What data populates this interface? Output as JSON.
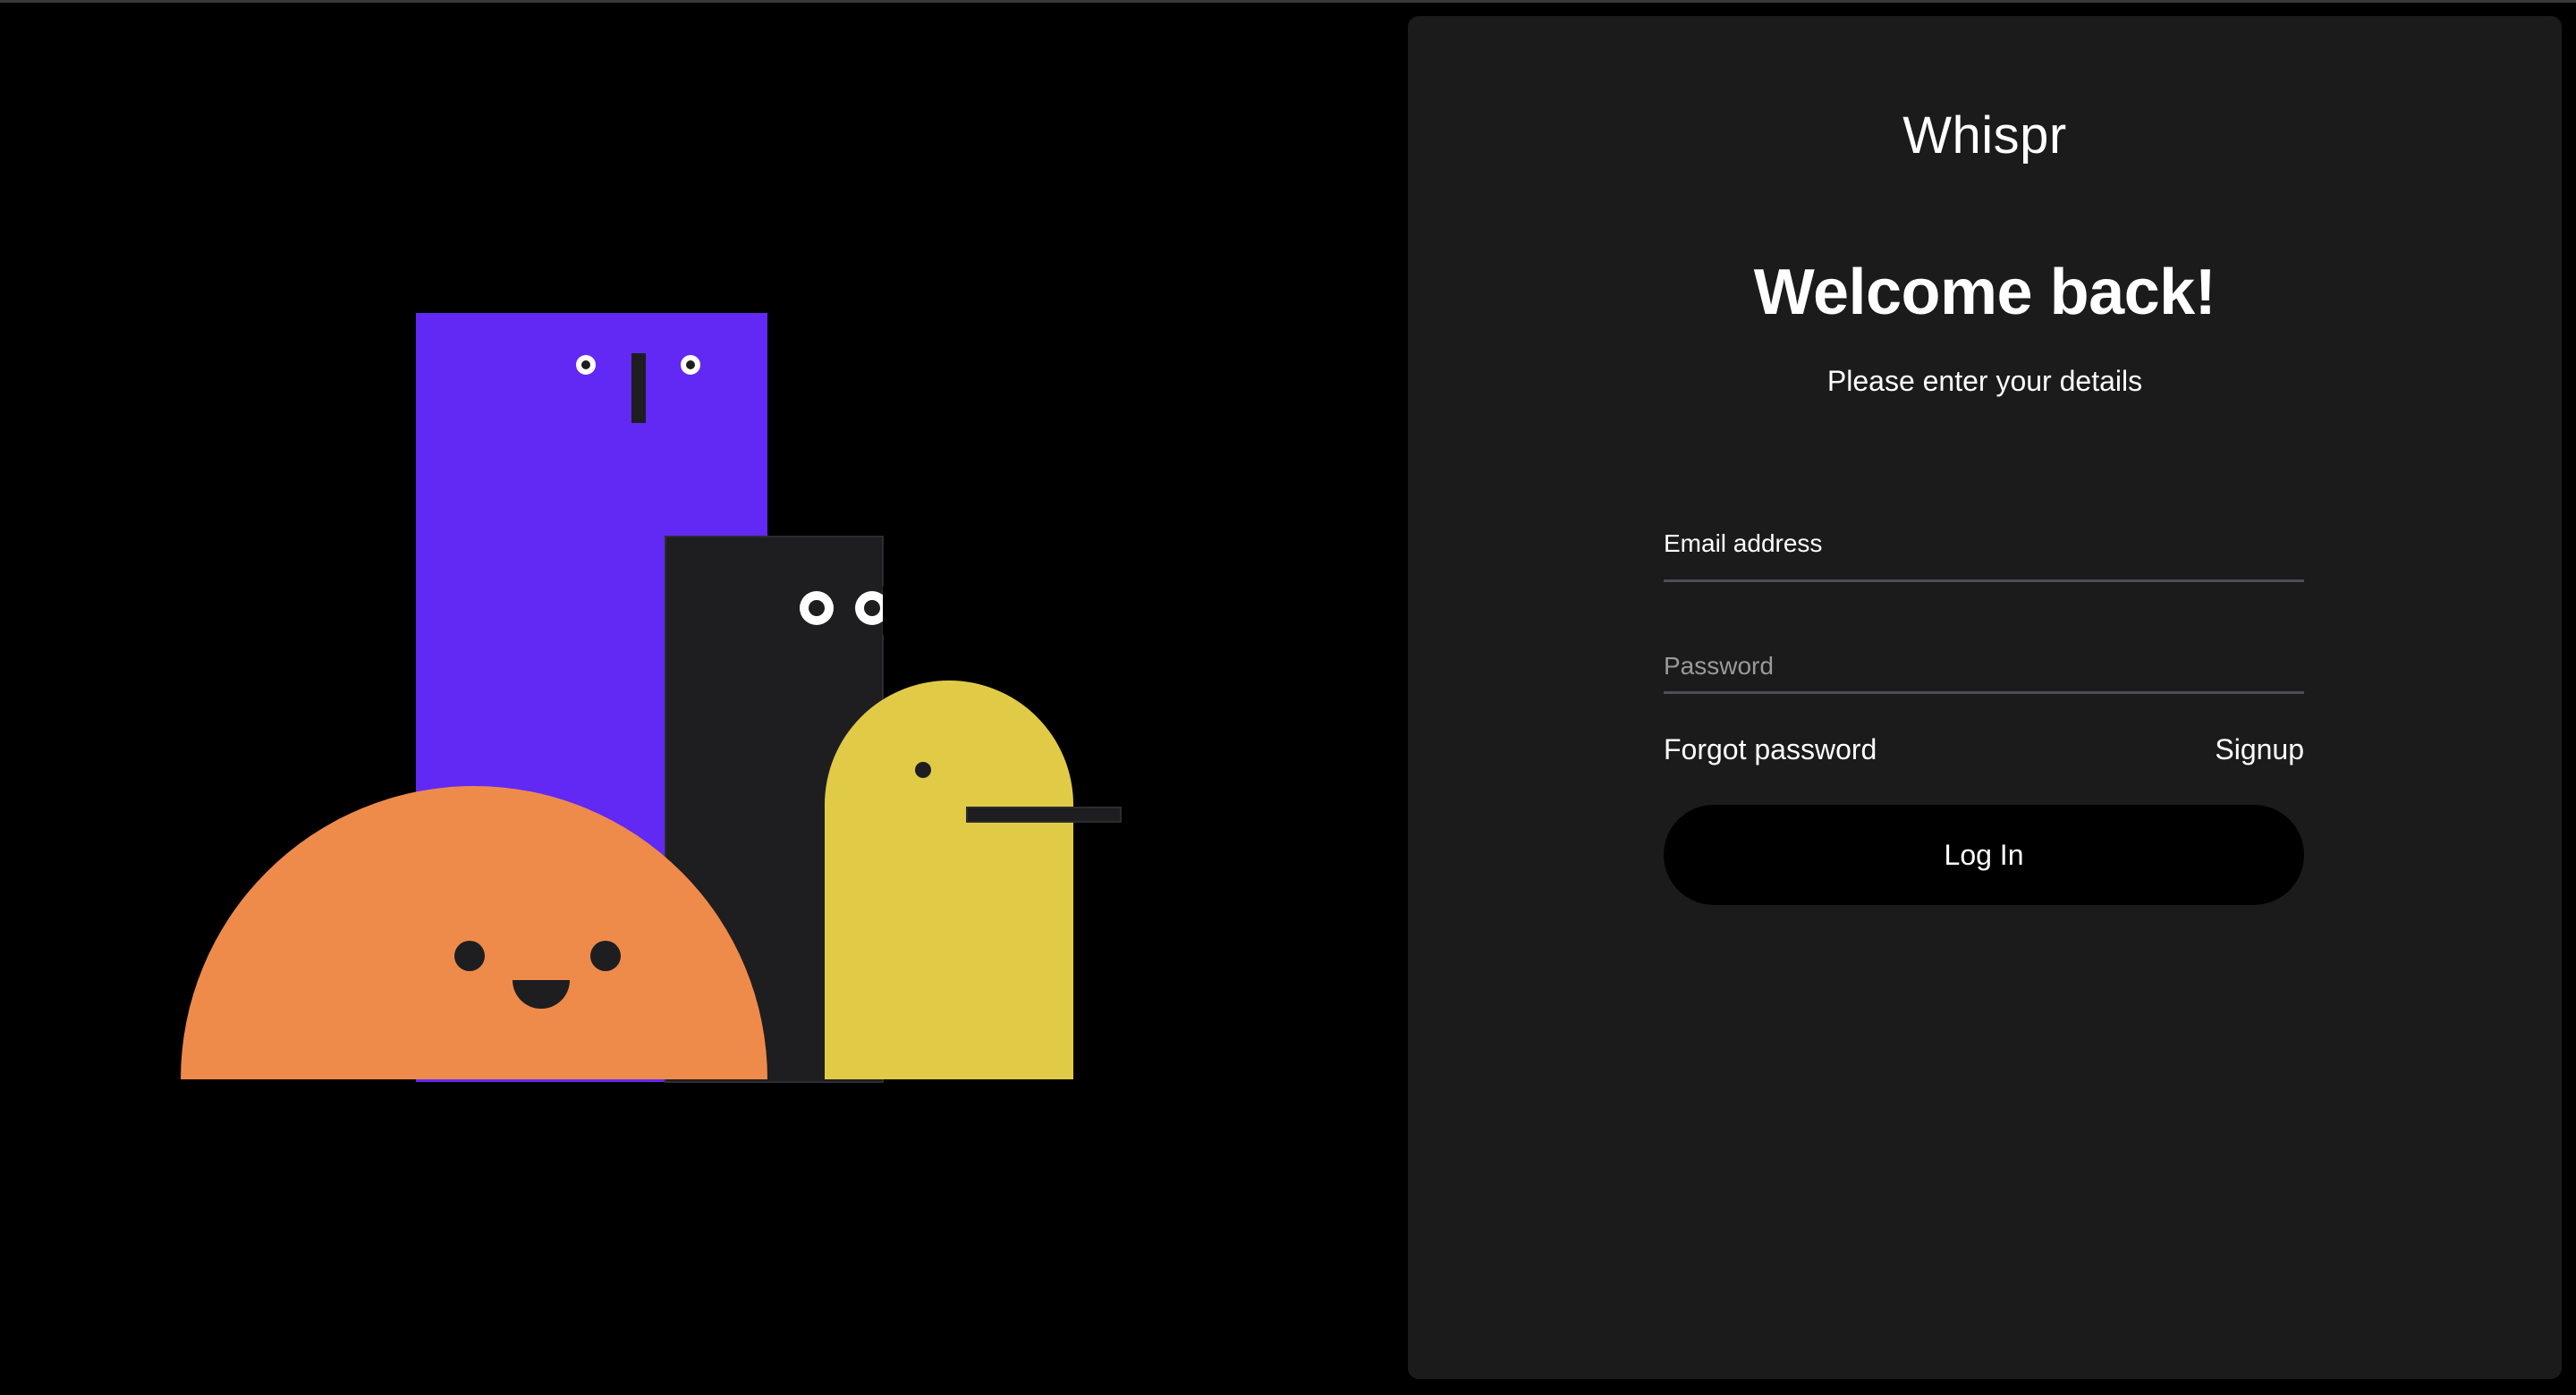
{
  "brand": {
    "name": "Whispr"
  },
  "auth": {
    "heading": "Welcome back!",
    "subheading": "Please enter your details",
    "email_label": "Email address",
    "email_value": "",
    "password_placeholder": "Password",
    "password_value": "",
    "forgot_password_label": "Forgot password",
    "signup_label": "Signup",
    "login_button_label": "Log In"
  },
  "colors": {
    "page_background": "#000000",
    "card_background": "#1b1b1b",
    "purple_character": "#6229f5",
    "dark_character": "#1e1e21",
    "yellow_character": "#e1cb46",
    "orange_character": "#ee8b4a",
    "input_underline": "#4d4f58",
    "button_background": "#000000"
  },
  "icons": {
    "illustration": "four-cartoon-shape-characters"
  }
}
